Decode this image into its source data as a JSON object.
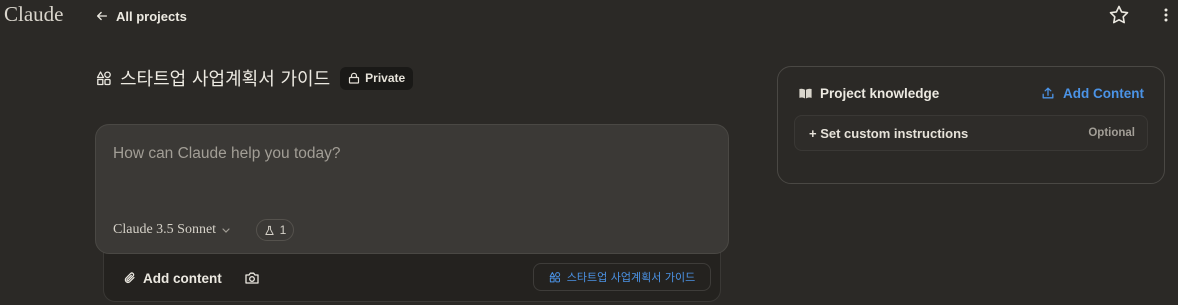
{
  "app": {
    "logo": "Claude"
  },
  "nav": {
    "back_label": "All projects"
  },
  "project": {
    "title": "스타트업 사업계획서 가이드",
    "visibility": "Private"
  },
  "composer": {
    "placeholder": "How can Claude help you today?",
    "model": "Claude 3.5 Sonnet",
    "style_count": "1"
  },
  "tray": {
    "add_content_label": "Add content",
    "project_chip_label": "스타트업 사업계획서 가이드"
  },
  "knowledge": {
    "title": "Project knowledge",
    "add_label": "Add Content",
    "instructions_label": "+ Set custom instructions",
    "optional_label": "Optional"
  },
  "icons": {
    "back": "arrow-left-icon",
    "star": "star-icon",
    "more": "more-vertical-icon",
    "project": "shapes-icon",
    "lock": "lock-icon",
    "chevron": "chevron-down-icon",
    "flask": "flask-icon",
    "paperclip": "paperclip-icon",
    "camera": "camera-icon",
    "book": "book-icon",
    "upload": "upload-icon"
  },
  "colors": {
    "background": "#2b2926",
    "composer": "#3b3936",
    "accent_blue": "#4b93e6"
  }
}
